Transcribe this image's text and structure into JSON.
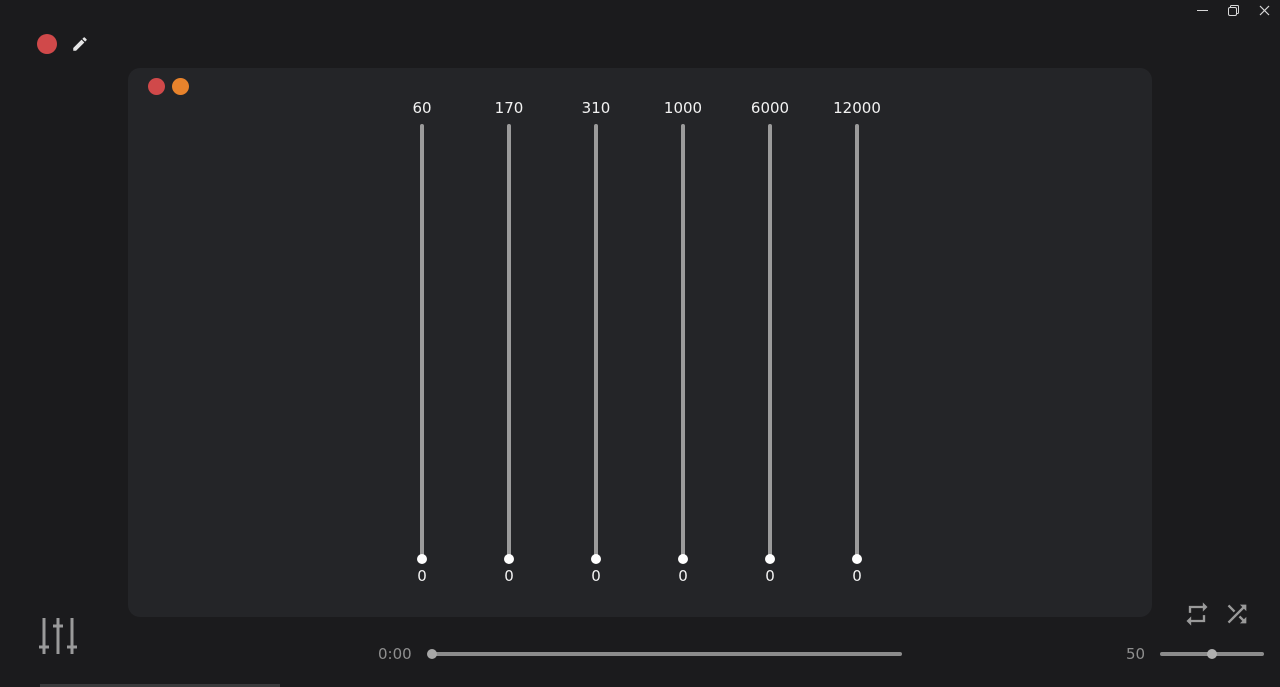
{
  "window": {
    "controls": [
      "minimize-icon",
      "restore-icon",
      "close-icon"
    ]
  },
  "toolbar": {
    "record_icon": "record-dot-icon",
    "edit_icon": "pencil-icon"
  },
  "panel": {
    "dots": [
      {
        "name": "red-dot",
        "color": "#d0494a"
      },
      {
        "name": "orange-dot",
        "color": "#e8832c"
      }
    ],
    "bands": [
      {
        "freq": "60",
        "gain": "0",
        "level": 0
      },
      {
        "freq": "170",
        "gain": "0",
        "level": 0
      },
      {
        "freq": "310",
        "gain": "0",
        "level": 0
      },
      {
        "freq": "1000",
        "gain": "0",
        "level": 0
      },
      {
        "freq": "6000",
        "gain": "0",
        "level": 0
      },
      {
        "freq": "12000",
        "gain": "0",
        "level": 0
      }
    ]
  },
  "player": {
    "time": "0:00",
    "progress": 0,
    "volume_label": "50",
    "volume": 0.5,
    "icons": [
      "equalizer-icon",
      "repeat-icon",
      "shuffle-icon"
    ]
  },
  "colors": {
    "background": "#1b1b1d",
    "panel": "#242528",
    "accent_red": "#d0494a",
    "accent_orange": "#e8832c"
  }
}
